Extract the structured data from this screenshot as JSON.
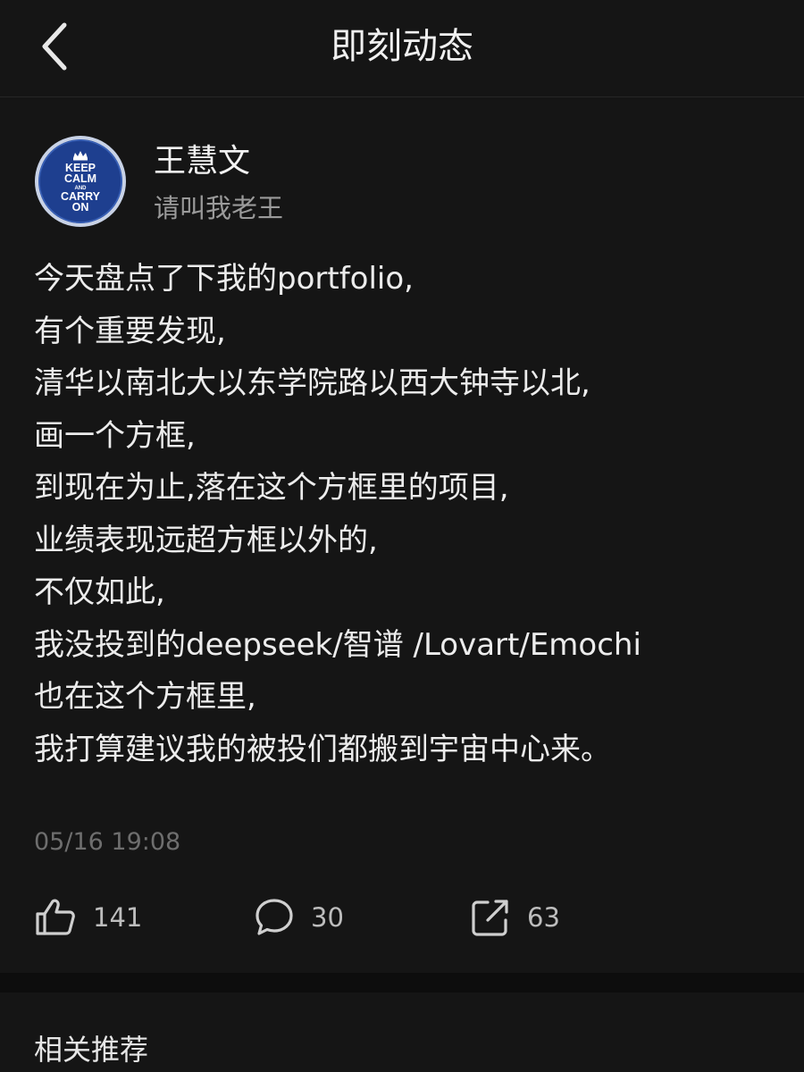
{
  "header": {
    "title": "即刻动态",
    "back_icon": "chevron-left-icon"
  },
  "author": {
    "name": "王慧文",
    "bio": "请叫我老王",
    "avatar": {
      "icon": "crown-icon",
      "line1": "KEEP",
      "line2": "CALM",
      "line3": "AND",
      "line4": "CARRY",
      "line5": "ON",
      "colors": {
        "background": "#1e3f8f",
        "rim": "#c8d2e6",
        "text": "#ffffff"
      }
    }
  },
  "post": {
    "lines": [
      "今天盘点了下我的portfolio,",
      "有个重要发现,",
      "清华以南北大以东学院路以西大钟寺以北,",
      "画一个方框,",
      "到现在为止,落在这个方框里的项目,",
      "业绩表现远超方框以外的,",
      "不仅如此,",
      "我没投到的deepseek/智谱 /Lovart/Emochi",
      "也在这个方框里,",
      "我打算建议我的被投们都搬到宇宙中心来。"
    ],
    "timestamp": "05/16 19:08"
  },
  "actions": {
    "like": {
      "icon": "thumbs-up-icon",
      "count": "141"
    },
    "comment": {
      "icon": "comment-bubble-icon",
      "count": "30"
    },
    "share": {
      "icon": "share-icon",
      "count": "63"
    }
  },
  "related": {
    "title": "相关推荐"
  },
  "colors": {
    "background": "#151515",
    "separator": "#0d0d0d",
    "text_primary": "#ececec",
    "text_secondary": "#9a9a9a",
    "text_muted": "#6e6e6e"
  }
}
